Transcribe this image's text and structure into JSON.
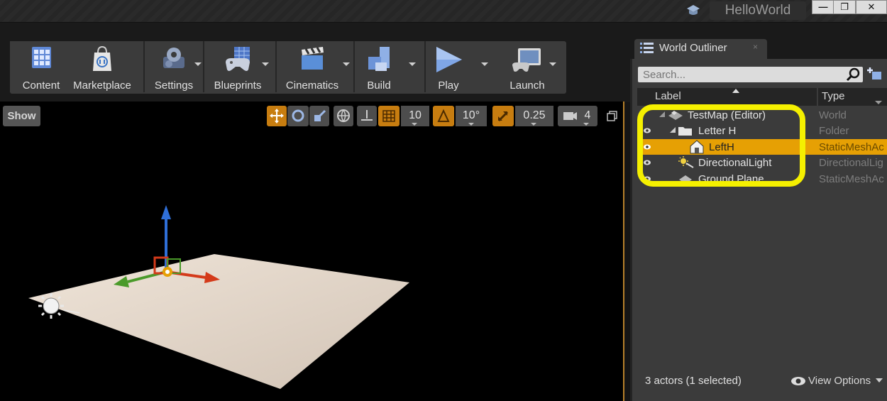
{
  "window": {
    "title": "HelloWorld",
    "minimize_label": "—",
    "maximize_label": "❐",
    "close_label": "✕"
  },
  "toolbar": {
    "items": [
      {
        "label": "Content",
        "icon": "content-icon"
      },
      {
        "label": "Marketplace",
        "icon": "marketplace-icon"
      },
      {
        "label": "Settings",
        "icon": "settings-icon"
      },
      {
        "label": "Blueprints",
        "icon": "blueprints-icon"
      },
      {
        "label": "Cinematics",
        "icon": "cinematics-icon"
      },
      {
        "label": "Build",
        "icon": "build-icon"
      },
      {
        "label": "Play",
        "icon": "play-icon"
      },
      {
        "label": "Launch",
        "icon": "launch-icon"
      }
    ]
  },
  "viewport": {
    "show_label": "Show",
    "grid_snap": "10",
    "rotation_snap": "10°",
    "scale_snap": "0.25",
    "camera_speed": "4"
  },
  "outliner": {
    "tab_label": "World Outliner",
    "tab_close": "×",
    "search_placeholder": "Search...",
    "columns": {
      "label": "Label",
      "type": "Type"
    },
    "rows": [
      {
        "label": "TestMap (Editor)",
        "type": "World",
        "icon": "world-icon"
      },
      {
        "label": "Letter H",
        "type": "Folder",
        "icon": "folder-icon"
      },
      {
        "label": "LeftH",
        "type": "StaticMeshAc",
        "icon": "static-mesh-icon",
        "selected": true
      },
      {
        "label": "DirectionalLight",
        "type": "DirectionalLig",
        "icon": "light-icon"
      },
      {
        "label": "Ground Plane",
        "type": "StaticMeshAc",
        "icon": "static-mesh-icon"
      }
    ],
    "status": "3 actors (1 selected)",
    "view_options_label": "View Options"
  },
  "colors": {
    "accent": "#e6a004",
    "highlight_ring": "#f5f000",
    "panel": "#3b3b3b",
    "viewport_bg": "#000000"
  }
}
